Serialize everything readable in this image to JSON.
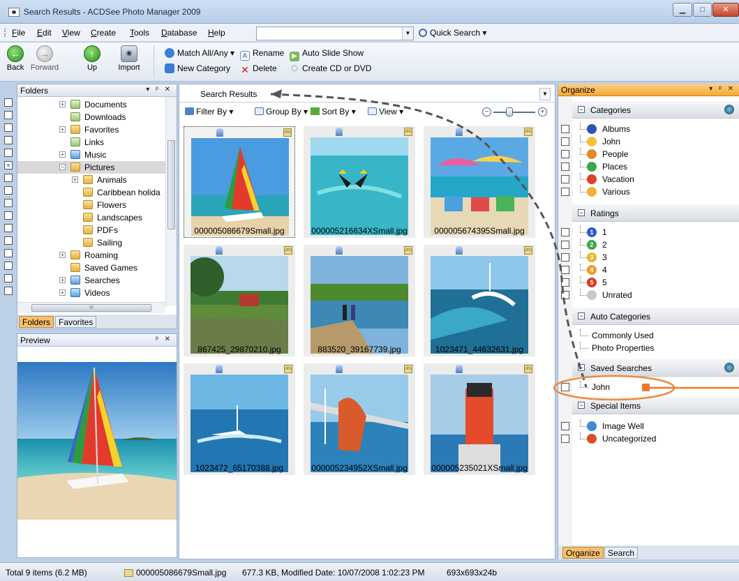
{
  "window": {
    "title": "Search Results - ACDSee Photo Manager 2009"
  },
  "menu": [
    {
      "u": "F",
      "rest": "ile"
    },
    {
      "u": "E",
      "rest": "dit"
    },
    {
      "u": "V",
      "rest": "iew"
    },
    {
      "u": "C",
      "rest": "reate"
    },
    {
      "u": "T",
      "rest": "ools"
    },
    {
      "u": "D",
      "rest": "atabase"
    },
    {
      "u": "H",
      "rest": "elp"
    }
  ],
  "quick_search": {
    "label": "Quick Search",
    "value": ""
  },
  "toolbar": {
    "back": "Back",
    "forward": "Forward",
    "up": "Up",
    "import": "Import",
    "match": "Match All/Any",
    "rename": "Rename",
    "slideshow": "Auto Slide Show",
    "new_category": "New Category",
    "delete": "Delete",
    "create_cd": "Create CD or DVD"
  },
  "folders": {
    "title": "Folders",
    "items": [
      {
        "label": "Documents",
        "icon": "document-folder"
      },
      {
        "label": "Downloads",
        "icon": "download-folder"
      },
      {
        "label": "Favorites",
        "icon": "star-folder"
      },
      {
        "label": "Links",
        "icon": "link-folder"
      },
      {
        "label": "Music",
        "icon": "music-folder"
      },
      {
        "label": "Pictures",
        "icon": "picture-folder"
      },
      {
        "label": "Animals",
        "icon": "folder"
      },
      {
        "label": "Caribbean holida",
        "icon": "folder"
      },
      {
        "label": "Flowers",
        "icon": "folder"
      },
      {
        "label": "Landscapes",
        "icon": "folder"
      },
      {
        "label": "PDFs",
        "icon": "folder"
      },
      {
        "label": "Sailing",
        "icon": "folder"
      },
      {
        "label": "Roaming",
        "icon": "folder"
      },
      {
        "label": "Saved Games",
        "icon": "folder"
      },
      {
        "label": "Searches",
        "icon": "search-folder"
      },
      {
        "label": "Videos",
        "icon": "video-folder"
      }
    ],
    "tabs": [
      "Folders",
      "Favorites"
    ],
    "scroll_glyph": "III"
  },
  "preview": {
    "title": "Preview"
  },
  "center": {
    "tab_title": "Search Results",
    "filter": "Filter By",
    "group": "Group By",
    "sort": "Sort By",
    "view": "View",
    "thumbnails": [
      "000005086679Small.jpg",
      "000005216634XSmall.jpg",
      "000005674395Small.jpg",
      "867425_29870210.jpg",
      "883520_39167739.jpg",
      "1023471_44632631.jpg",
      "1023472_65170388.jpg",
      "000005234952XSmall.jpg",
      "000005235021XSmall.jpg"
    ],
    "jpg_badge": "JPG"
  },
  "organize": {
    "title": "Organize",
    "sections": {
      "categories": "Categories",
      "ratings": "Ratings",
      "auto": "Auto Categories",
      "saved": "Saved Searches",
      "special": "Special Items"
    },
    "categories": [
      "Albums",
      "John",
      "People",
      "Places",
      "Vacation",
      "Various"
    ],
    "ratings": [
      "1",
      "2",
      "3",
      "4",
      "5",
      "Unrated"
    ],
    "auto": [
      "Commonly Used",
      "Photo Properties"
    ],
    "saved": [
      "John"
    ],
    "special": [
      "Image Well",
      "Uncategorized"
    ],
    "tabs": [
      "Organize",
      "Search"
    ]
  },
  "status": {
    "total": "Total 9 items  (6.2 MB)",
    "file": "000005086679Small.jpg",
    "info": "677.3 KB, Modified Date: 10/07/2008 1:02:23 PM",
    "dims": "693x693x24b"
  }
}
